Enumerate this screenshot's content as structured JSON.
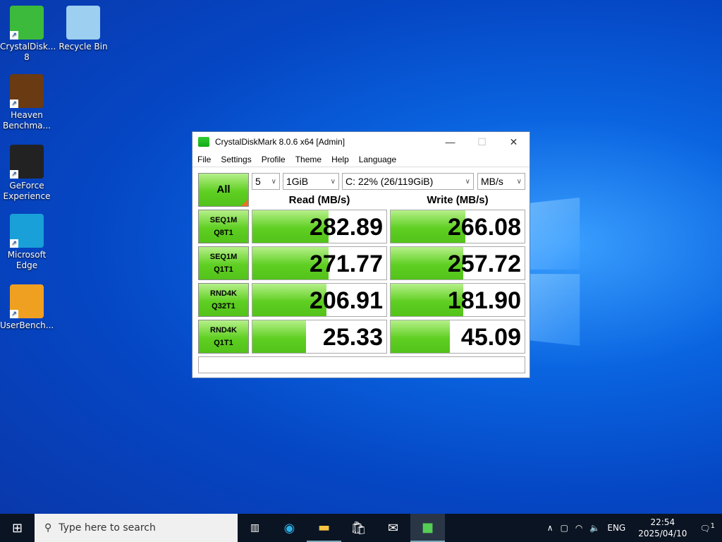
{
  "desktop": {
    "icons": [
      {
        "label": "CrystalDisk... 8",
        "color": "#3cba3c"
      },
      {
        "label": "Recycle Bin",
        "color": "#9ccff0"
      },
      {
        "label": "Heaven Benchma...",
        "color": "#6a3a12"
      },
      {
        "label": "GeForce Experience",
        "color": "#222222"
      },
      {
        "label": "Microsoft Edge",
        "color": "#1aa0d8"
      },
      {
        "label": "UserBench...",
        "color": "#f0a020"
      }
    ]
  },
  "window": {
    "title": "CrystalDiskMark 8.0.6 x64 [Admin]",
    "minimize": "—",
    "maximize": "☐",
    "close": "✕",
    "menu": [
      "File",
      "Settings",
      "Profile",
      "Theme",
      "Help",
      "Language"
    ],
    "all_label": "All",
    "count": "5",
    "size": "1GiB",
    "drive": "C: 22% (26/119GiB)",
    "unit": "MB/s",
    "read_header": "Read (MB/s)",
    "write_header": "Write (MB/s)",
    "rows": [
      {
        "l1": "SEQ1M",
        "l2": "Q8T1",
        "read": "282.89",
        "write": "266.08",
        "read_fill": 0.57,
        "write_fill": 0.56
      },
      {
        "l1": "SEQ1M",
        "l2": "Q1T1",
        "read": "271.77",
        "write": "257.72",
        "read_fill": 0.57,
        "write_fill": 0.54
      },
      {
        "l1": "RND4K",
        "l2": "Q32T1",
        "read": "206.91",
        "write": "181.90",
        "read_fill": 0.55,
        "write_fill": 0.54
      },
      {
        "l1": "RND4K",
        "l2": "Q1T1",
        "read": "25.33",
        "write": "45.09",
        "read_fill": 0.4,
        "write_fill": 0.44
      }
    ],
    "status": ""
  },
  "taskbar": {
    "search_placeholder": "Type here to search",
    "lang": "ENG",
    "time": "22:54",
    "date": "2025/04/10",
    "notifications": "1"
  }
}
